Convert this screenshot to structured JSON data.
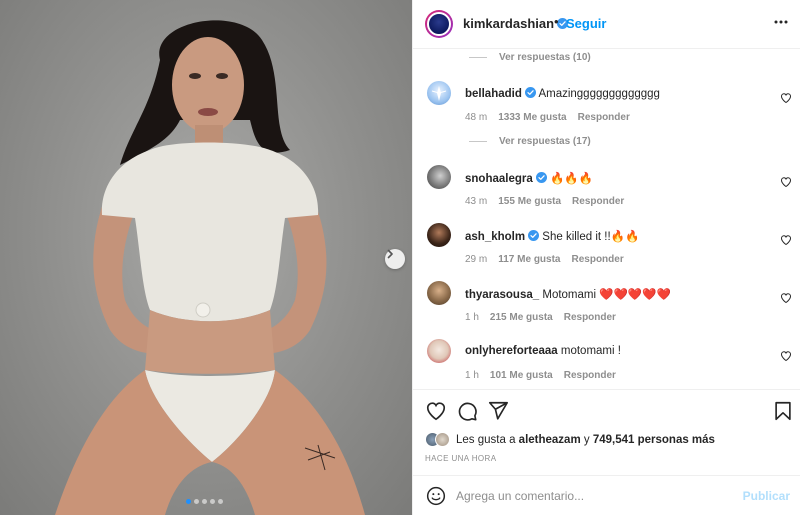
{
  "post": {
    "username": "kimkardashian",
    "separator": "•",
    "follow_label": "Seguir",
    "more_icon": "more-horizontal-icon"
  },
  "photo": {
    "carousel_count": 5,
    "carousel_active_index": 0,
    "next_icon": "chevron-right-icon"
  },
  "comments": {
    "replies": [
      {
        "label": "Ver respuestas (10)"
      },
      {
        "label": "Ver respuestas (17)"
      }
    ],
    "items": [
      {
        "user": "bellahadid",
        "verified": true,
        "text": "Amazinggggggggggggg",
        "time": "48 m",
        "likes": "1333 Me gusta",
        "reply": "Responder"
      },
      {
        "user": "snohaalegra",
        "verified": true,
        "text": "🔥🔥🔥",
        "time": "43 m",
        "likes": "155 Me gusta",
        "reply": "Responder"
      },
      {
        "user": "ash_kholm",
        "verified": true,
        "text": "She killed it !!🔥🔥",
        "time": "29 m",
        "likes": "117 Me gusta",
        "reply": "Responder"
      },
      {
        "user": "thyarasousa_",
        "verified": false,
        "text": "Motomami ❤️❤️❤️❤️❤️",
        "time": "1 h",
        "likes": "215 Me gusta",
        "reply": "Responder"
      },
      {
        "user": "onlyhereforteaaa",
        "verified": false,
        "text": "motomami !",
        "time": "1 h",
        "likes": "101 Me gusta",
        "reply": "Responder"
      }
    ]
  },
  "actions": {
    "like_icon": "heart-icon",
    "comment_icon": "comment-icon",
    "share_icon": "send-icon",
    "save_icon": "bookmark-icon",
    "likes_prefix": "Les gusta a",
    "likes_user": "aletheazam",
    "likes_joiner": "y",
    "likes_count": "749,541 personas más",
    "timestamp": "HACE UNA HORA"
  },
  "add_comment": {
    "emoji_icon": "smiley-icon",
    "placeholder": "Agrega un comentario...",
    "publish_label": "Publicar"
  },
  "colors": {
    "accent": "#0095f6",
    "verified": "#3897f0",
    "muted": "#8e8e8e",
    "publish_disabled": "#b2dffc",
    "carousel_active": "#1e90ff"
  }
}
